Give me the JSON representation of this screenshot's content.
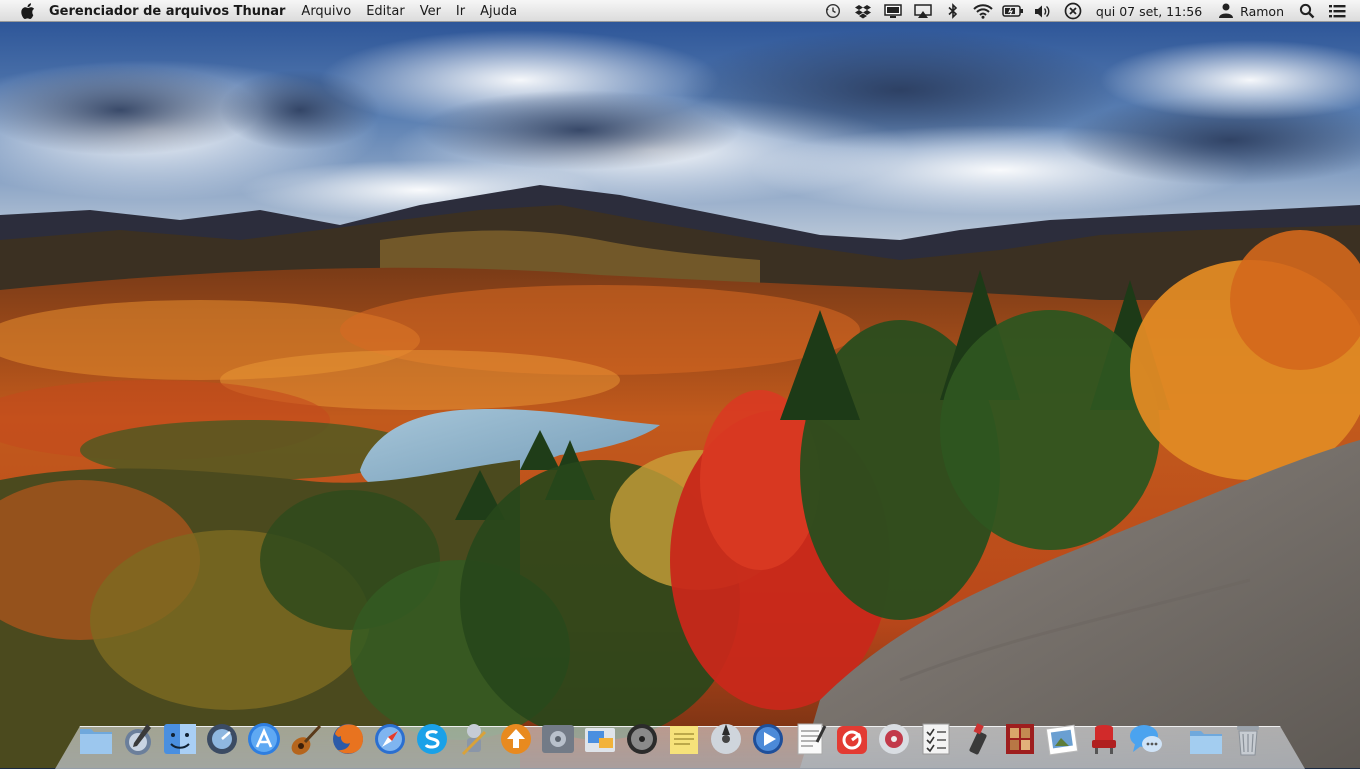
{
  "menubar": {
    "app_name": "Gerenciador de arquivos Thunar",
    "menus": [
      "Arquivo",
      "Editar",
      "Ver",
      "Ir",
      "Ajuda"
    ],
    "tray_icons": [
      "time-machine-icon",
      "dropbox-icon",
      "display-icon",
      "airplay-icon",
      "bluetooth-icon",
      "wifi-icon",
      "battery-icon",
      "volume-icon",
      "close-session-icon"
    ],
    "clock": "qui 07 set, 11:56",
    "user": "Ramon"
  },
  "dock": {
    "items": [
      "documents-folder-icon",
      "preferences-pen-icon",
      "finder-icon",
      "system-monitor-icon",
      "app-store-icon",
      "guitar-icon",
      "firefox-icon",
      "safari-icon",
      "skype-icon",
      "automator-icon",
      "software-update-icon",
      "settings-panel-icon",
      "preview-icon",
      "dvd-player-icon",
      "stickies-icon",
      "disc-icon",
      "media-player-icon",
      "textedit-icon",
      "radar-app-icon",
      "itunes-cd-icon",
      "checklist-icon",
      "usb-drive-icon",
      "photo-booth-icon",
      "image-viewer-icon",
      "theater-seat-icon",
      "messages-icon",
      "stack-folder-icon",
      "trash-icon"
    ]
  },
  "colors": {
    "menubar_bg": "#e6e6e6",
    "sky_top": "#2f5aa0",
    "foliage_orange": "#d8681f",
    "foliage_red": "#c82a18",
    "lake": "#8fb4cc",
    "rock": "#7c7670"
  }
}
